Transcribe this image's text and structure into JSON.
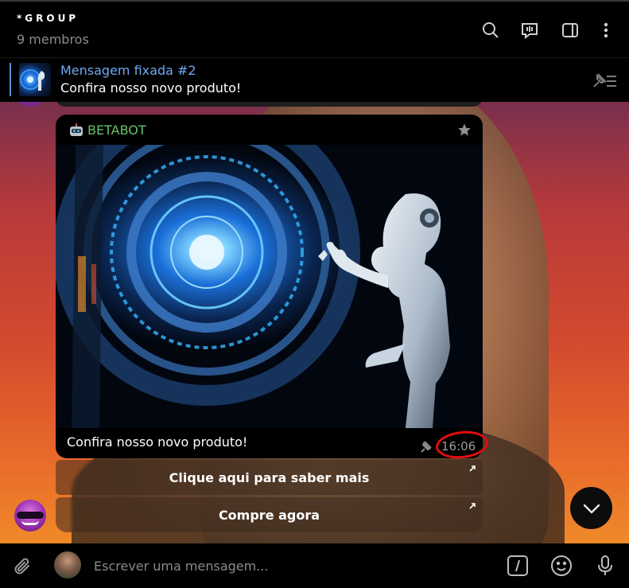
{
  "header": {
    "title": "*GROUP",
    "subtitle": "9 membros",
    "icons": [
      "search-icon",
      "live-chat-icon",
      "sidebar-toggle-icon",
      "more-vertical-icon"
    ]
  },
  "pinned": {
    "label": "Mensagem fixada #2",
    "text": "Confira nosso novo produto!",
    "icon": "pinned-list-icon"
  },
  "message": {
    "sender": "BETABOT",
    "sender_icon": "robot-icon",
    "caption": "Confira nosso novo produto!",
    "time": "16:06",
    "pinned": true
  },
  "inline_buttons": [
    {
      "label": "Clique aqui para saber mais"
    },
    {
      "label": "Compre agora"
    }
  ],
  "composer": {
    "placeholder": "Escrever uma mensagem..."
  },
  "colors": {
    "sender_name": "#66c26a",
    "pinned_label": "#6ea8f0",
    "annotation_circle": "#e30d0d",
    "background": "#000000"
  }
}
